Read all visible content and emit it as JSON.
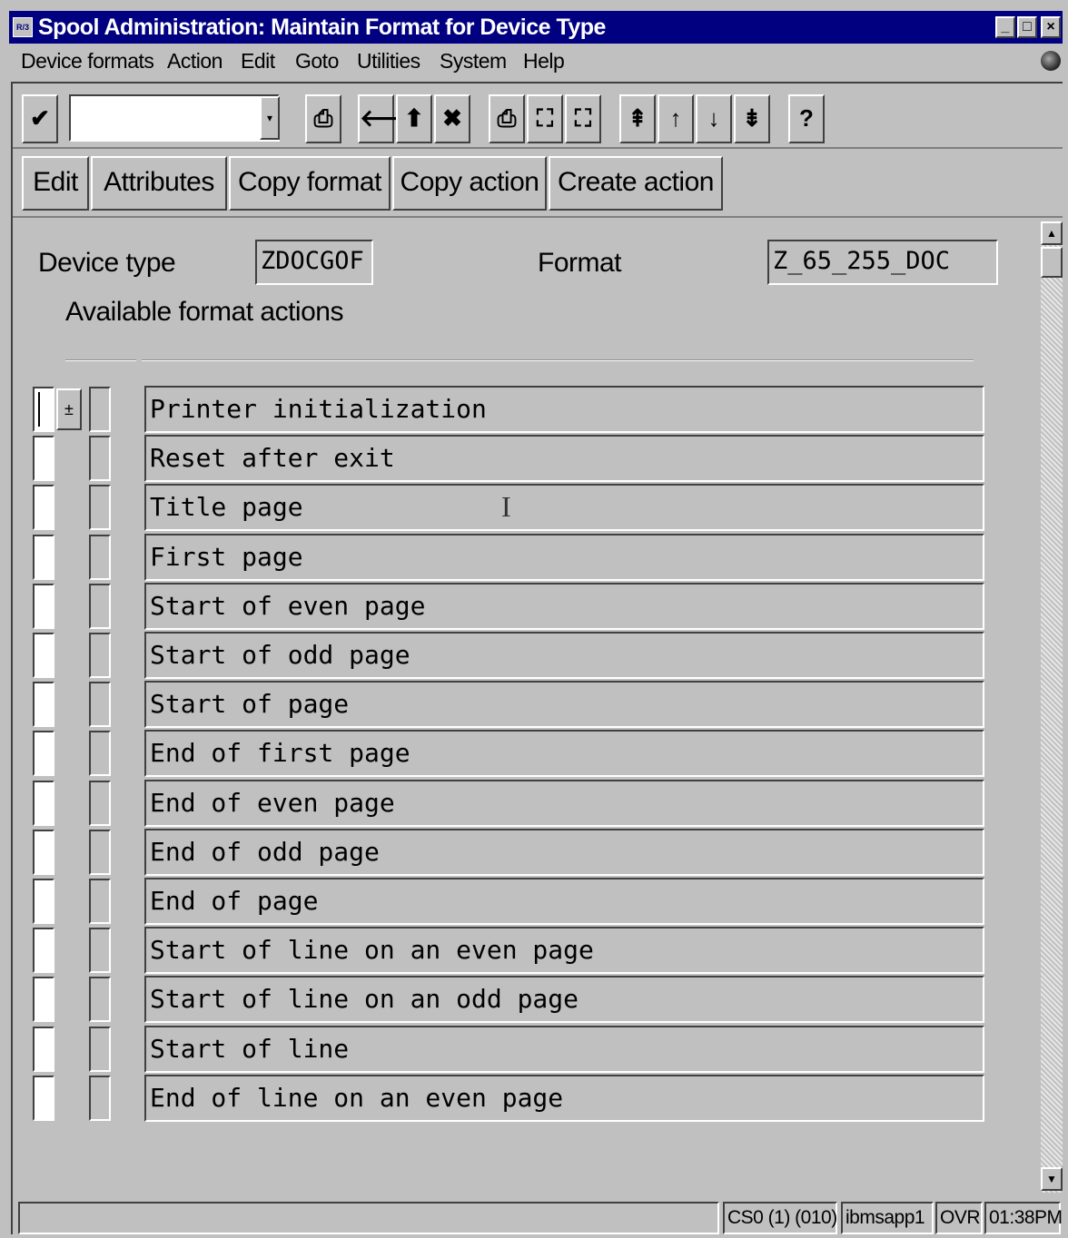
{
  "window": {
    "title": "Spool Administration: Maintain Format for Device Type",
    "icon_text": "R/3",
    "controls": {
      "minimize": "_",
      "maximize": "□",
      "close": "×"
    }
  },
  "menu": [
    "Device formats",
    "Action",
    "Edit",
    "Goto",
    "Utilities",
    "System",
    "Help"
  ],
  "toolbar": {
    "enter_icon": "✔",
    "command_value": "",
    "dropdown_icon": "▾",
    "icons": {
      "save": "⎙",
      "back": "🡐",
      "exit": "⬆",
      "cancel": "✖",
      "print": "⎙",
      "find": "⛶",
      "find_next": "⛶",
      "first_page": "⇞",
      "prev_page": "↑",
      "next_page": "↓",
      "last_page": "⇟",
      "help": "?"
    }
  },
  "app_toolbar": [
    "Edit",
    "Attributes",
    "Copy format",
    "Copy action",
    "Create action"
  ],
  "header": {
    "device_type_label": "Device type",
    "device_type_value": "ZDOCGOF",
    "format_label": "Format",
    "format_value": "Z_65_255_DOC",
    "section_label": "Available format actions"
  },
  "actions": [
    "Printer initialization",
    "Reset after exit",
    "Title page",
    "First page",
    "Start of even page",
    "Start of odd page",
    "Start of page",
    "End of first page",
    "End of even page",
    "End of odd page",
    "End of page",
    "Start of line on an even page",
    "Start of line on an odd page",
    "Start of line",
    "End of line on an even page"
  ],
  "cursor_icon": "I",
  "first_row_dropdown": "±",
  "scroll": {
    "up": "▲",
    "down": "▼"
  },
  "status": {
    "message": "",
    "system": "CS0 (1) (010)",
    "server": "ibmsapp1",
    "mode": "OVR",
    "time": "01:38PM"
  }
}
